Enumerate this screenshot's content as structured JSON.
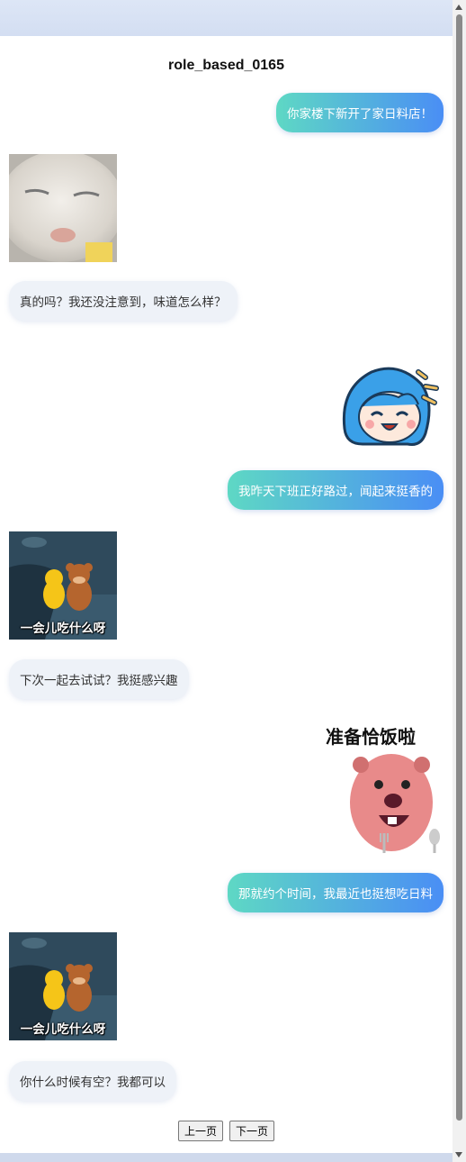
{
  "chat": {
    "title": "role_based_0165",
    "messages": [
      {
        "text": "你家楼下新开了家日料店！"
      },
      {
        "text": "真的吗？我还没注意到，味道怎么样？"
      },
      {
        "text": "我昨天下班正好路过，闻起来挺香的"
      },
      {
        "text": "下次一起去试试？我挺感兴趣"
      },
      {
        "text": "那就约个时间，我最近也挺想吃日料"
      },
      {
        "text": "你什么时候有空？我都可以"
      }
    ],
    "stickers": {
      "sticker1_caption": "一会儿吃什么呀",
      "sticker2_caption": "准备恰饭啦",
      "sticker3_caption": "一会儿吃什么呀"
    }
  },
  "pager": {
    "prev": "上一页",
    "next": "下一页"
  }
}
